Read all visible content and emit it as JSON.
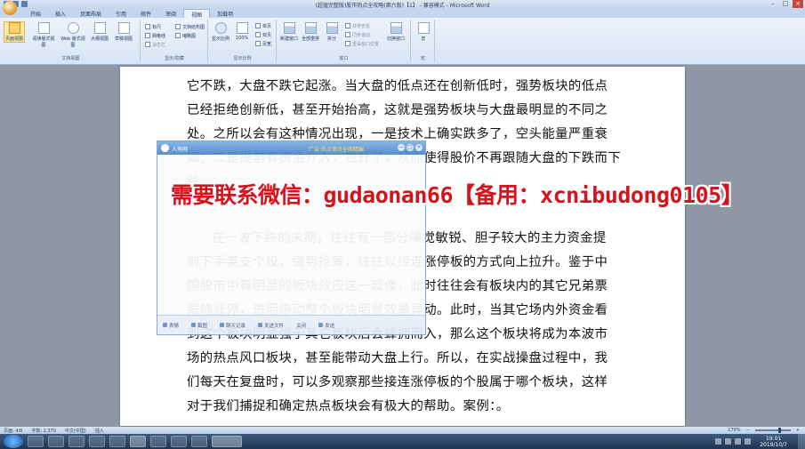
{
  "window": {
    "title": "(超值完整版)股市热点全攻略(第六版)【1】 - 兼容模式 - Microsoft Word"
  },
  "tabs": [
    "开始",
    "插入",
    "页面布局",
    "引用",
    "邮件",
    "审阅",
    "视图",
    "加载项"
  ],
  "active_tab": "视图",
  "ribbon": {
    "views_group": {
      "label": "文档视图",
      "buttons": [
        "页面视图",
        "阅读版式视图",
        "Web 版式视图",
        "大纲视图",
        "草稿视图"
      ]
    },
    "show_group": {
      "label": "显示/隐藏",
      "checks": [
        "标尺",
        "网格线",
        "消息栏",
        "文档结构图",
        "缩略图"
      ]
    },
    "zoom_group": {
      "label": "显示比例",
      "buttons": [
        "显示比例",
        "100%",
        "单页",
        "双页",
        "页宽"
      ]
    },
    "window_group": {
      "label": "窗口",
      "buttons": [
        "新建窗口",
        "全部重排",
        "拆分",
        "并排查看",
        "同步滚动",
        "重设窗口位置",
        "切换窗口"
      ]
    },
    "macro_group": {
      "label": "宏",
      "buttons": [
        "宏"
      ]
    }
  },
  "document": {
    "lines": [
      "它不跌，大盘不跌它起涨。当大盘的低点还在创新低时，强势板块的低点",
      "已经拒绝创新低，甚至开始抬高，这就是强势板块与大盘最明显的不同之",
      "处。之所以会有这种情况出现，一是技术上确实跌多了，空头能量严重衰",
      "竭；二是提前有资金介入，拉升了，从而使得股价不再跟随大盘的下跌而下",
      "跌。",
      "",
      "在一波下跌的末期，往往有一部分嗅觉敏锐、胆子较大的主力资金提",
      "前下手某支个股，强势抢筹，往往以接连涨停板的方式向上拉升。鉴于中",
      "国股市中有明显的板块效应这一现像，此时往往会有板块内的其它兄弟票",
      "跟随涨停，进而带动整个板块明显效量异动。此时，当其它场内外资金看",
      "到这个板块明显强于其它板块后会蜂拥而入，那么这个板块将成为本波市",
      "场的热点风口板块，甚至能带动大盘上行。所以，在实战操盘过程中，我",
      "们每天在复盘时，可以多观察那些接连涨停板的个股属于哪个板块，这样",
      "对于我们捕捉和确定热点板块会有极大的帮助。案例：。"
    ]
  },
  "chat": {
    "name": "人寿网",
    "ad_text": "广告·热点资讯全网精编",
    "controls": [
      "—",
      "□",
      "×"
    ],
    "footer": [
      "表情",
      "截图",
      "聊天记录",
      "发送文件",
      "关闭",
      "发送"
    ]
  },
  "banner": {
    "text": "需要联系微信：gudaonan66【备用：xcnibudong0105】"
  },
  "statusbar": {
    "page": "页面: 4/8",
    "words": "字数: 2,370",
    "lang": "中文(中国)",
    "mode": "插入",
    "zoom": "170%"
  },
  "taskbar": {
    "time": "19:01",
    "date": "2019/10/7"
  },
  "colors": {
    "banner_red": "#d6131c",
    "ribbon_active": "#fde8a8",
    "chat_header": "#4b86cc"
  }
}
